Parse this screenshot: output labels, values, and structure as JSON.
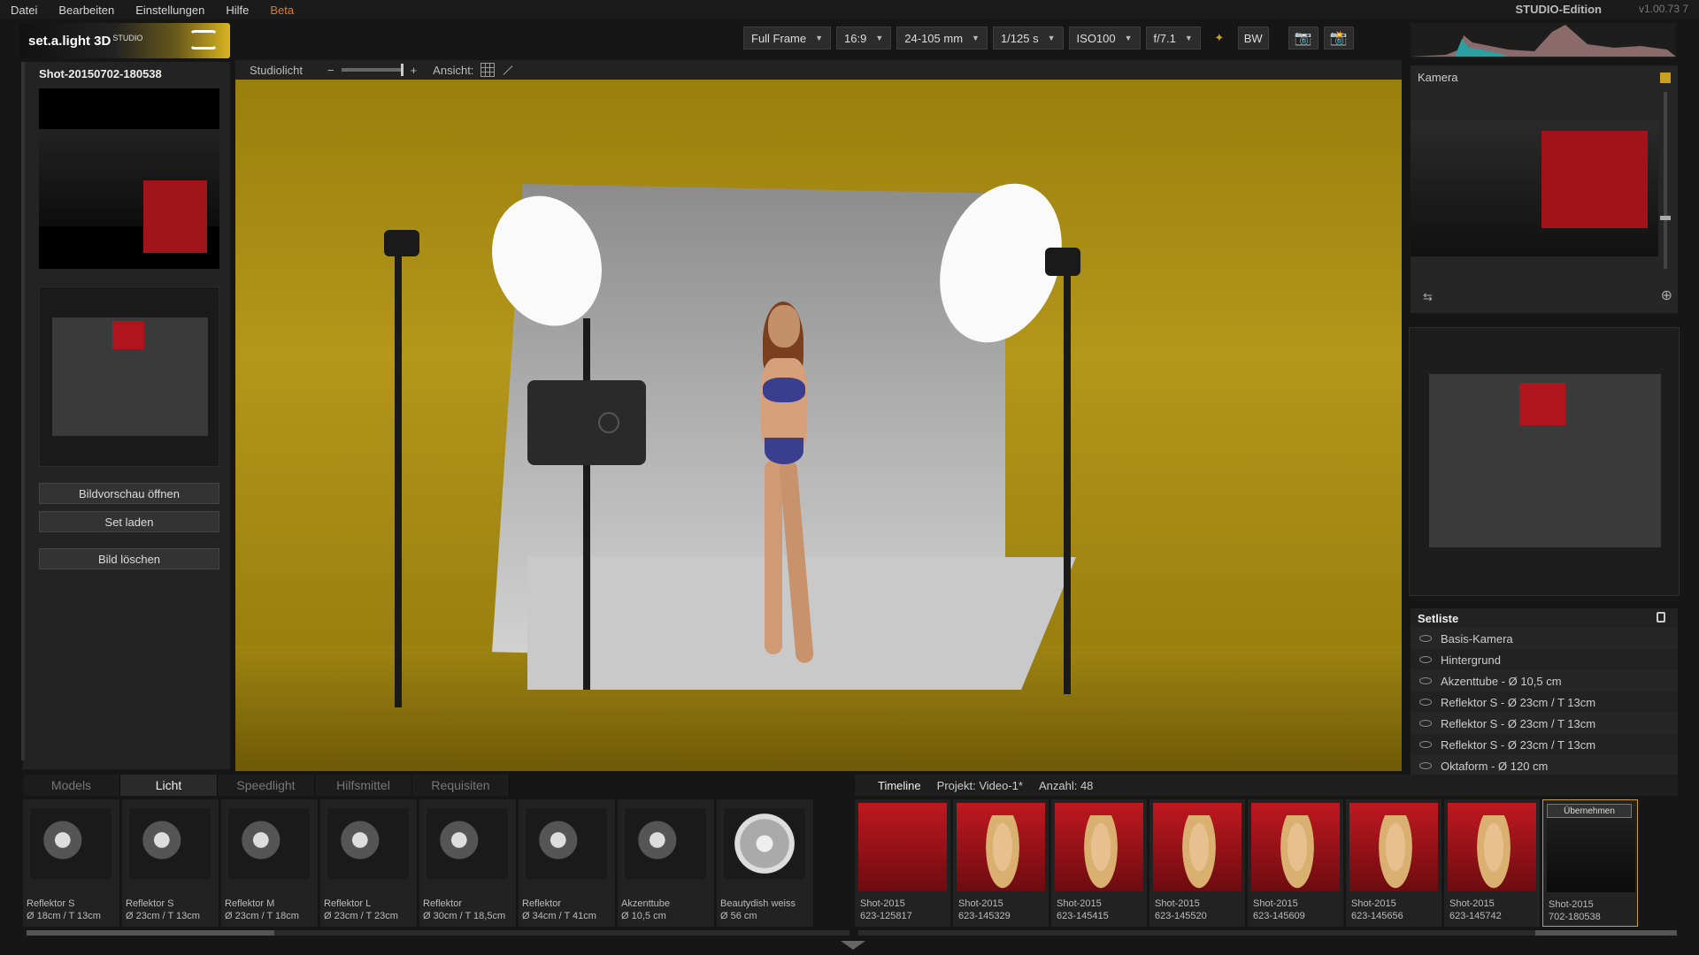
{
  "menu": {
    "items": [
      "Datei",
      "Bearbeiten",
      "Einstellungen",
      "Hilfe"
    ],
    "beta": "Beta",
    "edition": "STUDIO-Edition",
    "version": "v1.00.73 7"
  },
  "logo": {
    "text": "set.a.light 3D",
    "sup": "STUDIO"
  },
  "toolbar": {
    "format": "Full Frame",
    "ratio": "16:9",
    "lens": "24-105 mm",
    "shutter": "1/125 s",
    "iso": "ISO100",
    "aperture": "f/7.1",
    "bw": "BW"
  },
  "left": {
    "shot_title": "Shot-20150702-180538",
    "buttons": [
      "Bildvorschau öffnen",
      "Set laden",
      "Bild löschen"
    ]
  },
  "view_toolbar": {
    "studiolicht": "Studiolicht",
    "minus": "−",
    "plus": "+",
    "ansicht": "Ansicht:"
  },
  "kamera": {
    "label": "Kamera"
  },
  "setliste": {
    "title": "Setliste",
    "items": [
      "Basis-Kamera",
      "Hintergrund",
      "Akzenttube - Ø 10,5 cm",
      "Reflektor S - Ø 23cm / T 13cm",
      "Reflektor S - Ø 23cm / T 13cm",
      "Reflektor S - Ø 23cm / T 13cm",
      "Oktaform - Ø 120 cm"
    ]
  },
  "tabs": [
    "Models",
    "Licht",
    "Speedlight",
    "Hilfsmittel",
    "Requisiten"
  ],
  "lights": [
    {
      "n1": "Reflektor S",
      "n2": "Ø 18cm / T 13cm"
    },
    {
      "n1": "Reflektor S",
      "n2": "Ø 23cm / T 13cm"
    },
    {
      "n1": "Reflektor M",
      "n2": "Ø 23cm / T 18cm"
    },
    {
      "n1": "Reflektor L",
      "n2": "Ø 23cm / T 23cm"
    },
    {
      "n1": "Reflektor",
      "n2": "Ø 30cm / T 18,5cm"
    },
    {
      "n1": "Reflektor",
      "n2": "Ø 34cm / T 41cm"
    },
    {
      "n1": "Akzenttube",
      "n2": "Ø 10,5 cm"
    },
    {
      "n1": "Beautydish weiss",
      "n2": "Ø 56 cm"
    }
  ],
  "timeline": {
    "label": "Timeline",
    "projekt": "Projekt: Video-1*",
    "anzahl": "Anzahl: 48"
  },
  "shots": [
    {
      "n1": "Shot-2015",
      "n2": "623-125817"
    },
    {
      "n1": "Shot-2015",
      "n2": "623-145329"
    },
    {
      "n1": "Shot-2015",
      "n2": "623-145415"
    },
    {
      "n1": "Shot-2015",
      "n2": "623-145520"
    },
    {
      "n1": "Shot-2015",
      "n2": "623-145609"
    },
    {
      "n1": "Shot-2015",
      "n2": "623-145656"
    },
    {
      "n1": "Shot-2015",
      "n2": "623-145742"
    },
    {
      "n1": "Shot-2015",
      "n2": "702-180538"
    }
  ],
  "uebernehmen": "Übernehmen"
}
